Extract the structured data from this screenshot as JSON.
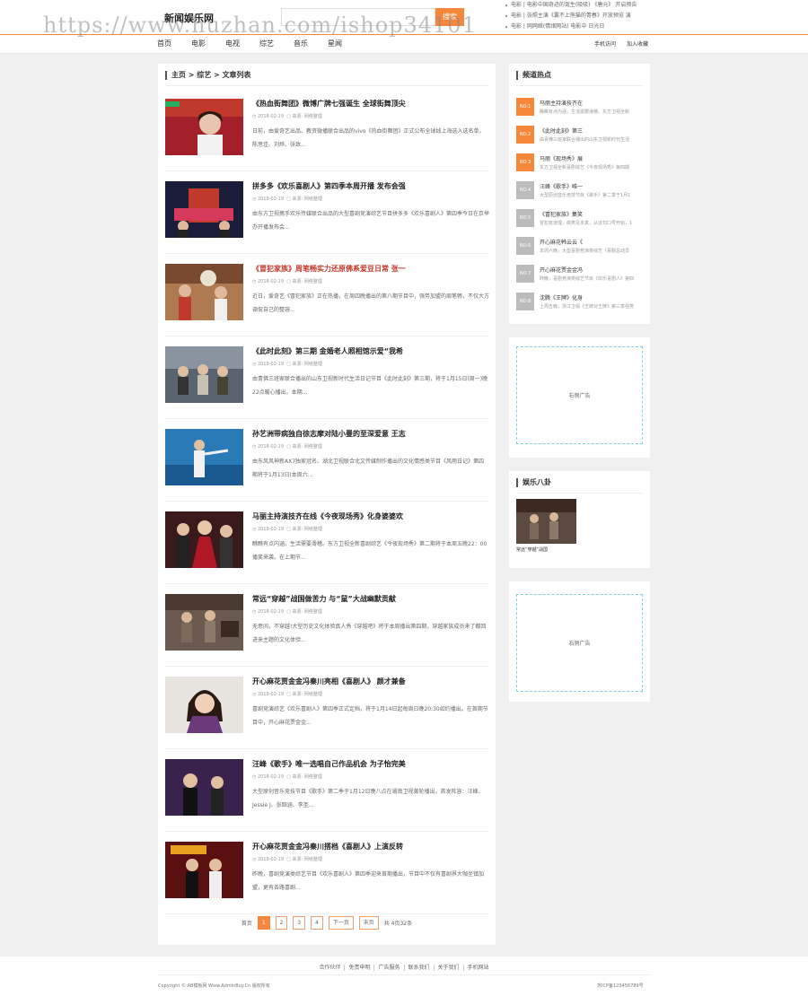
{
  "watermark": "https://www.huzhan.com/ishop34101",
  "header": {
    "logo": "新闻娱乐网",
    "search_placeholder": "",
    "search_button": "搜索",
    "ticker": [
      "电影 | 电影中国奇迹的诞生(吸吸)  《唐元》 开启预告",
      "电影 | 张照主演《囊不上熊猫的青春》开放预览 演",
      "电影 | 网网络(情绪网站)  电影中 日光日"
    ]
  },
  "nav": {
    "items": [
      "首页",
      "电影",
      "电视",
      "综艺",
      "音乐",
      "星闻"
    ],
    "right": [
      "手机访问",
      "加入收藏"
    ]
  },
  "breadcrumb": "主页 > 综艺 > 文章列表",
  "articles": [
    {
      "title": "《热血街舞团》微博广牌七强诞生 全球街舞顶尖",
      "date": "2018-02-19",
      "source": "来源: 网络整理",
      "summary": "日前，由爱奇艺出品、教资微播联合出品的vivo《热血街舞团》正式公布全球线上海选入选名单，陈思佳、刘烨、张致...",
      "highlight": false
    },
    {
      "title": "拼多多《欢乐喜剧人》第四季本周开播 发布会强",
      "date": "2018-02-19",
      "source": "来源: 网络整理",
      "summary": "由东方卫视携手欢乐传媒联合出品的大型喜剧竞演综艺节目拼多多《欢乐喜剧人》第四季今日在京举办开播发布会...",
      "highlight": false
    },
    {
      "title": "《冒犯家族》周笔畅实力还原佛系爱豆日常 张一",
      "date": "2018-02-19",
      "source": "来源: 网络整理",
      "summary": "近日，爱奇艺《冒犯家族》正在热播，在周四晚播出的第八期节目中，强势加盟的周笔畅，不仅大方调侃自己的整容...",
      "highlight": true
    },
    {
      "title": "《此时此刻》第三期 金婚老人照相馆示爱“我希",
      "date": "2018-02-19",
      "source": "来源: 网络整理",
      "summary": "由青佛三班家联合播出的山东卫视新时代生活日记节目《此时此刻》第三期，将于1月15日(周一)晚22点暖心播出。本期...",
      "highlight": false
    },
    {
      "title": "孙艺洲带病独自徐志摩对陆小曼的至深爱意 王志",
      "date": "2018-02-19",
      "source": "来源: 网络整理",
      "summary": "由东风风神新AX7独家冠名、湖北卫视联合北文传媒制作播出的文化情感类节目《风雨日记》第四期将于1月13日(本周六...",
      "highlight": false
    },
    {
      "title": "马丽主持演技齐在线《今夜现场秀》化身婆婆欢",
      "date": "2018-02-19",
      "source": "来源: 网络整理",
      "summary": "瞧瞧有点内涵，生活需要滑稽。东方卫视全新喜剧综艺《今夜现场秀》第二期将于本周五晚22：00播笑来袭。在上期节...",
      "highlight": false
    },
    {
      "title": "常远“穿越”战国做苦力 与“鼠”大战幽默贡献",
      "date": "2018-02-19",
      "source": "来源: 网络整理",
      "summary": "无意间，不穿越!大型历史文化体验真人秀《穿越吧》将于本周播出第四期，穿越家族成员来了都回进来主题的文化体验...",
      "highlight": false
    },
    {
      "title": "开心麻花贾金金冯秦川亮相《喜剧人》 颜才兼备",
      "date": "2018-02-19",
      "source": "来源: 网络整理",
      "summary": "喜剧竞演综艺《欢乐喜剧人》第四季正式定档，将于1月14日起每周日晚20:30如约播出。在首期节目中，开心麻花贾金金...",
      "highlight": false
    },
    {
      "title": "汪峰《歌手》唯一选唱自己作品机会 为子怡完美",
      "date": "2018-02-19",
      "source": "来源: 网络整理",
      "summary": "大型原创音乐竞技节目《歌手》第二季于1月12日晚八点在湖南卫视黄轮播出，首发阵容：汪峰、Jessie J、张韶涵、李圣...",
      "highlight": false
    },
    {
      "title": "开心麻花贾金金冯秦川搭档《喜剧人》上演反转",
      "date": "2018-02-19",
      "source": "来源: 网络整理",
      "summary": "昨晚，喜剧竞演类综艺节目《欢乐喜剧人》第四季迎来首期播出，节目中不仅有喜剧界大咖坐镇加盟，更有各路喜剧...",
      "highlight": false
    }
  ],
  "pagination": {
    "first": "首页",
    "pages": [
      "1",
      "2",
      "3",
      "4"
    ],
    "active": "1",
    "next": "下一页",
    "last": "末页",
    "summary": "共 4页32条"
  },
  "hot": {
    "title": "频道热点",
    "items": [
      {
        "badge": "NO.1",
        "title": "马丽主持演技齐在",
        "desc": "瞧瞧有点内涵，生活需要滑稽。东方卫视全新",
        "color": "#f5863a"
      },
      {
        "badge": "NO.2",
        "title": "《此时此刻》第三",
        "desc": "由青佛三班家联合播出的山东卫视新时代生活",
        "color": "#f5863a"
      },
      {
        "badge": "NO.3",
        "title": "马丽《现场秀》展",
        "desc": "东方卫视全新喜剧综艺《今夜现场秀》第四期",
        "color": "#f5863a"
      },
      {
        "badge": "NO.4",
        "title": "汪峰《歌手》唯一",
        "desc": "大型原创音乐竞技节目《歌手》第二季于1月1",
        "color": "#bbbbbb"
      },
      {
        "badge": "NO.5",
        "title": "《冒犯家族》集笑",
        "desc": "冒犯有道理，搞笑见本真，从这句口号开始，1",
        "color": "#bbbbbb"
      },
      {
        "badge": "NO.6",
        "title": "开心麻花韩云云《",
        "desc": "本周六晚，大型喜剧竞演类综艺《喜剧总动员",
        "color": "#bbbbbb"
      },
      {
        "badge": "NO.7",
        "title": "开心麻花贾金金冯",
        "desc": "昨晚，喜剧竞演类综艺节目《欢乐喜剧人》第四",
        "color": "#bbbbbb"
      },
      {
        "badge": "NO.8",
        "title": "沈腾《王牌》化身",
        "desc": "上周五晚，浙江卫视《王牌对王牌》第三季强势",
        "color": "#bbbbbb"
      }
    ]
  },
  "ads": {
    "label": "右侧广告"
  },
  "gossip": {
    "title": "娱乐八卦",
    "caption": "常远“穿越”战国"
  },
  "footer": {
    "links": [
      "合作伙伴",
      "免责申明",
      "广告服务",
      "联系我们",
      "关于我们",
      "手机网站"
    ],
    "copyright": "Copyright © AB模板网 Www.AdminBuy.Cn 版权所有",
    "icp": "苏ICP备123456789号"
  }
}
